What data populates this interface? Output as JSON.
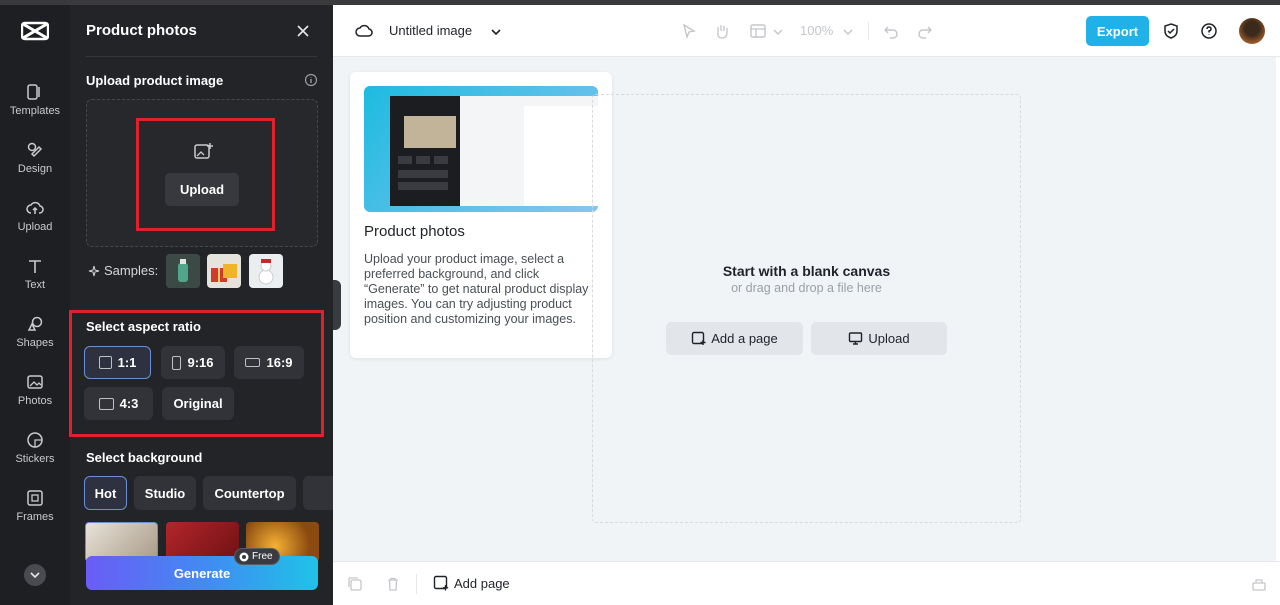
{
  "rail": {
    "items": [
      {
        "label": "Templates",
        "icon": "templates-icon"
      },
      {
        "label": "Design",
        "icon": "design-icon"
      },
      {
        "label": "Upload",
        "icon": "upload-cloud-icon"
      },
      {
        "label": "Text",
        "icon": "text-icon"
      },
      {
        "label": "Shapes",
        "icon": "shapes-icon"
      },
      {
        "label": "Photos",
        "icon": "photos-icon"
      },
      {
        "label": "Stickers",
        "icon": "stickers-icon"
      },
      {
        "label": "Frames",
        "icon": "frames-icon"
      }
    ]
  },
  "panel": {
    "title": "Product photos",
    "upload_section_title": "Upload product image",
    "upload_button": "Upload",
    "samples_label": "Samples:",
    "aspect_title": "Select aspect ratio",
    "aspect_ratios": [
      {
        "label": "1:1",
        "active": true
      },
      {
        "label": "9:16",
        "active": false
      },
      {
        "label": "16:9",
        "active": false
      },
      {
        "label": "4:3",
        "active": false
      },
      {
        "label": "Original",
        "active": false
      }
    ],
    "background_title": "Select background",
    "background_tabs": [
      {
        "label": "Hot",
        "active": true
      },
      {
        "label": "Studio",
        "active": false
      },
      {
        "label": "Countertop",
        "active": false
      }
    ],
    "generate_button": "Generate",
    "free_badge": "Free"
  },
  "topbar": {
    "doc_title": "Untitled image",
    "zoom": "100%",
    "export_button": "Export"
  },
  "tutorial": {
    "title": "Product photos",
    "description": "Upload your product image, select a preferred background, and click “Generate” to get natural product display images. You can try adjusting product position and customizing your images."
  },
  "canvas": {
    "title": "Start with a blank canvas",
    "subtitle": "or drag and drop a file here",
    "add_page_button": "Add a page",
    "upload_button": "Upload"
  },
  "bottombar": {
    "add_page": "Add page"
  },
  "colors": {
    "accent": "#1fb1e8",
    "highlight_box": "#e0202a",
    "panel_bg": "#232428"
  }
}
